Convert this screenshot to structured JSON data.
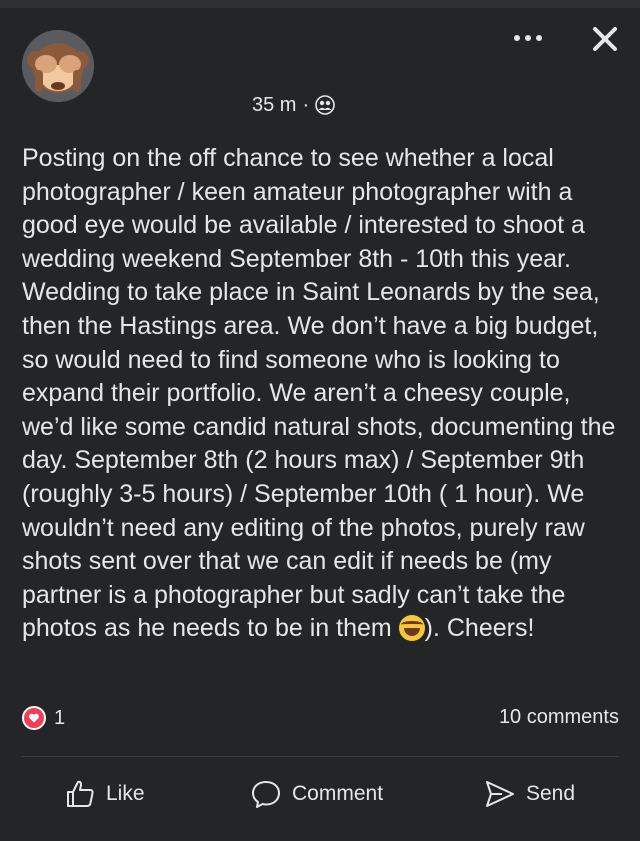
{
  "post": {
    "time": "35 m",
    "separator": "·",
    "body_before_emoji": "Posting on the off chance to see whether a local photographer / keen amateur photographer with a good eye would be available / interested to shoot a wedding weekend September 8th - 10th this year. Wedding to take place in Saint Leonards by the sea, then the Hastings area. We don’t have a big budget, so would need to find someone who is looking to expand their portfolio. We aren’t a cheesy couple, we’d like some candid natural shots, documenting the day. September 8th (2 hours max) / September 9th (roughly 3-5 hours) / September 10th ( 1 hour). We wouldn’t need any editing of the photos, purely raw shots sent over that we can edit if needs be (my partner is a photographer but sadly can’t take the photos as he needs to be in them ",
    "emoji": "rolling-on-floor-laughing-emoji",
    "body_after_emoji": "). Cheers!"
  },
  "reactions": {
    "icon": "love-icon",
    "count": "1",
    "comments": "10 comments"
  },
  "actions": {
    "like": "Like",
    "comment": "Comment",
    "send": "Send"
  },
  "colors": {
    "background": "#242526",
    "text": "#e4e6eb",
    "love": "#f33e58",
    "divider": "#3e4042"
  }
}
